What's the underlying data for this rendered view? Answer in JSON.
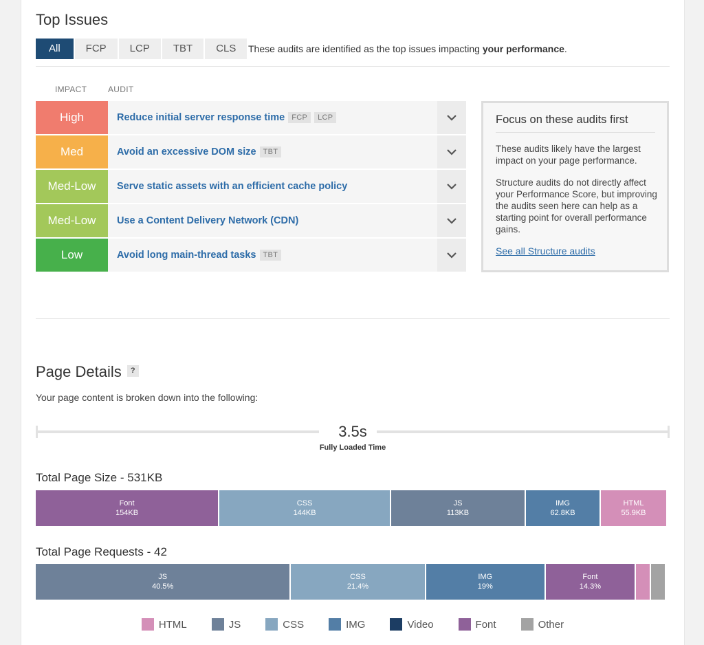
{
  "top_issues": {
    "title": "Top Issues",
    "tabs": [
      "All",
      "FCP",
      "LCP",
      "TBT",
      "CLS"
    ],
    "active_tab": "All",
    "description_prefix": "These audits are identified as the top issues impacting ",
    "description_bold": "your performance",
    "description_suffix": ".",
    "col_impact": "IMPACT",
    "col_audit": "AUDIT",
    "audits": [
      {
        "impact": "High",
        "color": "#f07c6e",
        "title": "Reduce initial server response time",
        "tags": [
          "FCP",
          "LCP"
        ]
      },
      {
        "impact": "Med",
        "color": "#f6b04a",
        "title": "Avoid an excessive DOM size",
        "tags": [
          "TBT"
        ]
      },
      {
        "impact": "Med-Low",
        "color": "#a3c85a",
        "title": "Serve static assets with an efficient cache policy",
        "tags": []
      },
      {
        "impact": "Med-Low",
        "color": "#a3c85a",
        "title": "Use a Content Delivery Network (CDN)",
        "tags": []
      },
      {
        "impact": "Low",
        "color": "#47b04b",
        "title": "Avoid long main-thread tasks",
        "tags": [
          "TBT"
        ]
      }
    ],
    "focus": {
      "title": "Focus on these audits first",
      "p1": "These audits likely have the largest impact on your page performance.",
      "p2": "Structure audits do not directly affect your Performance Score, but improving the audits seen here can help as a starting point for overall performance gains.",
      "link": "See all Structure audits"
    }
  },
  "page_details": {
    "title": "Page Details",
    "help": "?",
    "subtitle": "Your page content is broken down into the following:",
    "fully_loaded_value": "3.5s",
    "fully_loaded_label": "Fully Loaded Time",
    "size_title": "Total Page Size - 531KB",
    "requests_title": "Total Page Requests - 42"
  },
  "chart_data": [
    {
      "type": "bar",
      "title": "Total Page Size - 531KB",
      "categories": [
        "Font",
        "CSS",
        "JS",
        "IMG",
        "HTML"
      ],
      "labels": [
        "154KB",
        "144KB",
        "113KB",
        "62.8KB",
        "55.9KB"
      ],
      "values": [
        154,
        144,
        113,
        62.8,
        55.9
      ]
    },
    {
      "type": "bar",
      "title": "Total Page Requests - 42",
      "categories": [
        "JS",
        "CSS",
        "IMG",
        "Font",
        "HTML",
        "Other"
      ],
      "labels": [
        "40.5%",
        "21.4%",
        "19%",
        "14.3%",
        "",
        ""
      ],
      "values": [
        40.5,
        21.4,
        19,
        14.3,
        2.4,
        2.4
      ]
    }
  ],
  "legend": [
    {
      "name": "HTML",
      "color": "#d48fb8"
    },
    {
      "name": "JS",
      "color": "#6e8199"
    },
    {
      "name": "CSS",
      "color": "#87a7c0"
    },
    {
      "name": "IMG",
      "color": "#537ea6"
    },
    {
      "name": "Video",
      "color": "#1c3d63"
    },
    {
      "name": "Font",
      "color": "#8f6199"
    },
    {
      "name": "Other",
      "color": "#a3a3a3"
    }
  ]
}
